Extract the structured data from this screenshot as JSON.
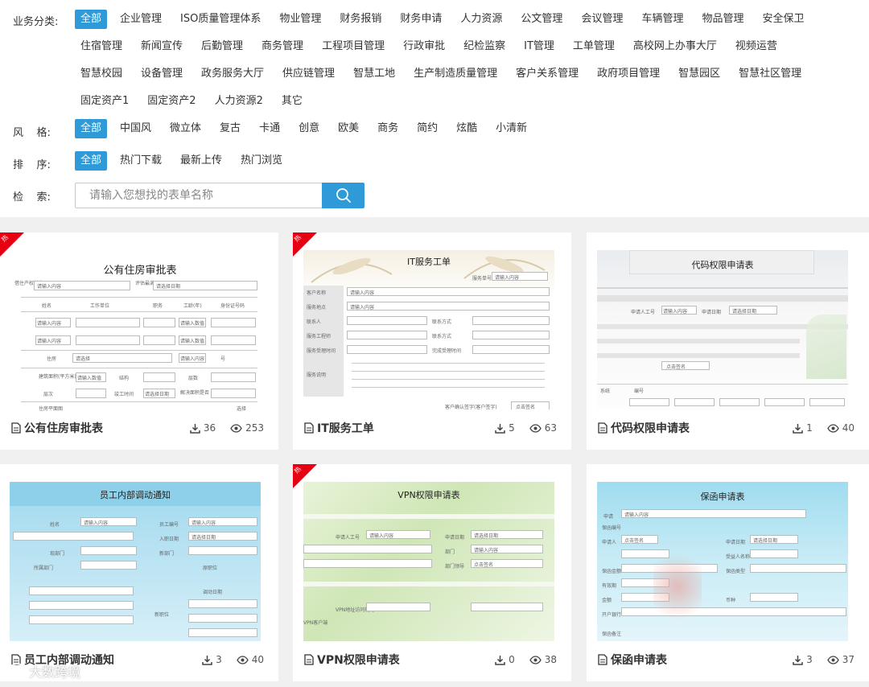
{
  "filters": {
    "category": {
      "label": "业务分类:",
      "rows": [
        [
          "全部",
          "企业管理",
          "ISO质量管理体系",
          "物业管理",
          "财务报销",
          "财务申请",
          "人力资源",
          "公文管理",
          "会议管理",
          "车辆管理",
          "物品管理",
          "安全保卫"
        ],
        [
          "住宿管理",
          "新闻宣传",
          "后勤管理",
          "商务管理",
          "工程项目管理",
          "行政审批",
          "纪检监察",
          "IT管理",
          "工单管理",
          "高校网上办事大厅",
          "视频运营"
        ],
        [
          "智慧校园",
          "设备管理",
          "政务服务大厅",
          "供应链管理",
          "智慧工地",
          "生产制造质量管理",
          "客户关系管理",
          "政府项目管理",
          "智慧园区",
          "智慧社区管理"
        ],
        [
          "固定资产1",
          "固定资产2",
          "人力资源2",
          "其它"
        ]
      ]
    },
    "style": {
      "label": "风    格:",
      "options": [
        "全部",
        "中国风",
        "微立体",
        "复古",
        "卡通",
        "创意",
        "欧美",
        "商务",
        "简约",
        "炫酷",
        "小清新"
      ]
    },
    "sort": {
      "label": "排    序:",
      "options": [
        "全部",
        "热门下载",
        "最新上传",
        "热门浏览"
      ]
    },
    "search": {
      "label": "检    索:",
      "placeholder": "请输入您想找的表单名称"
    }
  },
  "accent_color": "#2e9ad8",
  "hot_badge": "热",
  "cards": [
    {
      "title": "公有住房审批表",
      "downloads": "36",
      "views": "253",
      "hot": true,
      "thumb_title": "公有住房审批表",
      "thumb_texts": [
        "借住产权单位",
        "请输入内容",
        "评估最满日",
        "请选择日期",
        "姓名",
        "工作单位",
        "职务",
        "工龄(年)",
        "身份证号码",
        "请输入内容",
        "请输入数值",
        "请输入内容",
        "请输入数值",
        "住房",
        "请选择",
        "请输入内容",
        "号",
        "建筑面积(平方米)",
        "请输入数值",
        "结构",
        "层数",
        "层次",
        "竣工时间",
        "请选择日期",
        "解决面积是否",
        "住房平面图",
        "选择"
      ]
    },
    {
      "title": "IT服务工单",
      "downloads": "5",
      "views": "63",
      "hot": true,
      "thumb_title": "IT服务工单",
      "thumb_texts": [
        "服务单号",
        "请输入内容",
        "客户名称",
        "请输入内容",
        "服务地点",
        "请输入内容",
        "联系人",
        "联系方式",
        "服务工程师",
        "联系方式",
        "服务受理时间",
        "完成受理时间",
        "服务说明",
        "客户确认签字(客户签字)",
        "点击签名"
      ]
    },
    {
      "title": "代码权限申请表",
      "downloads": "1",
      "views": "40",
      "hot": false,
      "thumb_title": "代码权限申请表",
      "thumb_texts": [
        "申请人工号",
        "请输入内容",
        "申请日期",
        "请选择日期",
        "点击签名",
        "系统",
        "编号"
      ]
    },
    {
      "title": "员工内部调动通知",
      "downloads": "3",
      "views": "40",
      "hot": false,
      "thumb_title": "员工内部调动通知",
      "thumb_texts": [
        "姓名",
        "请输入内容",
        "员工编号",
        "请输入内容",
        "入职日期",
        "请选择日期",
        "现部门",
        "新部门",
        "所属部门",
        "原职位",
        "新职位",
        "调动日期"
      ]
    },
    {
      "title": "VPN权限申请表",
      "downloads": "0",
      "views": "38",
      "hot": true,
      "thumb_title": "VPN权限申请表",
      "thumb_texts": [
        "申请人工号",
        "请输入内容",
        "申请日期",
        "请选择日期",
        "部门",
        "请输入内容",
        "部门领导",
        "点击签名",
        "VPN地址访问规则",
        "VPN客户端"
      ]
    },
    {
      "title": "保函申请表",
      "downloads": "3",
      "views": "37",
      "hot": false,
      "thumb_title": "保函申请表",
      "thumb_texts": [
        "申请",
        "请输入内容",
        "保函编号",
        "申请人",
        "点击签名",
        "申请日期",
        "请选择日期",
        "受益人名称",
        "保函金额",
        "保函类型",
        "有效期",
        "金额",
        "币种",
        "开户银行",
        "保函备注"
      ]
    }
  ],
  "watermark_text": "大数跨境"
}
